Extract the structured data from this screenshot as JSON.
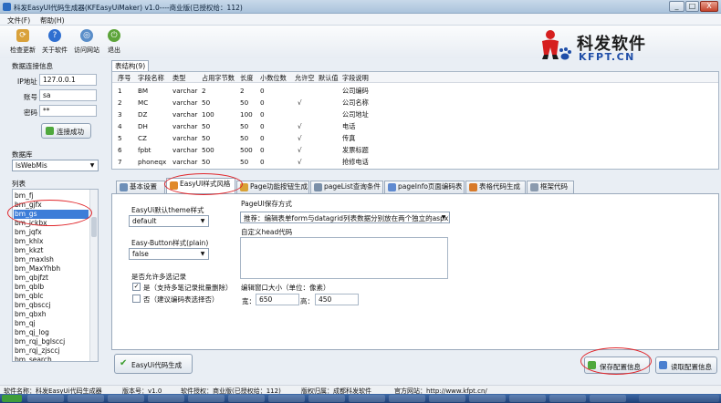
{
  "window": {
    "title": "科发EasyUI代码生成器(KFEasyUiMaker) v1.0----商业版(已授权给：112)",
    "min_label": "_",
    "max_label": "□",
    "close_label": "X"
  },
  "menu": [
    "文件(F)",
    "帮助(H)"
  ],
  "toolbar": {
    "items": [
      {
        "label": "检查更新",
        "icon": "refresh-icon"
      },
      {
        "label": "关于软件",
        "icon": "help-icon"
      },
      {
        "label": "访问网站",
        "icon": "globe-icon"
      },
      {
        "label": "退出",
        "icon": "exit-icon"
      }
    ]
  },
  "logo": {
    "cn": "科发软件",
    "en": "KFPT.CN"
  },
  "connection": {
    "section_title": "数据连接信息",
    "ip_label": "IP地址",
    "ip_value": "127.0.0.1",
    "account_label": "账号",
    "account_value": "sa",
    "password_label": "密码",
    "password_value": "**",
    "connect_status": "连接成功"
  },
  "database": {
    "label": "数据库",
    "selected": "lsWebMis"
  },
  "tables": {
    "label": "列表",
    "items": [
      "bm_fj",
      "bm_gjfx",
      "bm_gs",
      "bm_jckbx",
      "bm_jqfx",
      "bm_khlx",
      "bm_kkzt",
      "bm_maxlsh",
      "bm_MaxYhbh",
      "bm_qbjfzt",
      "bm_qblb",
      "bm_qblc",
      "bm_qbsccj",
      "bm_qbxh",
      "bm_qj",
      "bm_qj_log",
      "bm_rqj_bglsccj",
      "bm_rqj_zjsccj",
      "bm_search"
    ],
    "selected_index": 2
  },
  "structure": {
    "tab_label": "表结构(9)",
    "columns": [
      "序号",
      "字段名称",
      "类型",
      "占用字节数",
      "长度",
      "小数位数",
      "允许空",
      "默认值",
      "字段说明"
    ],
    "rows": [
      [
        "1",
        "BM",
        "varchar",
        "2",
        "2",
        "0",
        "",
        "",
        "公司编码"
      ],
      [
        "2",
        "MC",
        "varchar",
        "50",
        "50",
        "0",
        "√",
        "",
        "公司名称"
      ],
      [
        "3",
        "DZ",
        "varchar",
        "100",
        "100",
        "0",
        "",
        "",
        "公司地址"
      ],
      [
        "4",
        "DH",
        "varchar",
        "50",
        "50",
        "0",
        "√",
        "",
        "电话"
      ],
      [
        "5",
        "CZ",
        "varchar",
        "50",
        "50",
        "0",
        "√",
        "",
        "传真"
      ],
      [
        "6",
        "fpbt",
        "varchar",
        "500",
        "500",
        "0",
        "√",
        "",
        "发票标题"
      ],
      [
        "7",
        "phoneqx",
        "varchar",
        "50",
        "50",
        "0",
        "√",
        "",
        "抢修电话"
      ]
    ]
  },
  "tabs": [
    {
      "label": "基本设置",
      "color": "#6d8fb8"
    },
    {
      "label": "EasyUI样式风格",
      "color": "#e08a2a"
    },
    {
      "label": "Page功能按钮生成",
      "color": "#d9a236"
    },
    {
      "label": "pageList查询条件",
      "color": "#7a8fa8"
    },
    {
      "label": "pageInfo页面编码表",
      "color": "#5f8ad0"
    },
    {
      "label": "表格代码生成",
      "color": "#d87a2a"
    },
    {
      "label": "框架代码",
      "color": "#8a9aae"
    }
  ],
  "active_tab": 1,
  "style_panel": {
    "theme_label": "EasyUi默认theme样式",
    "theme_value": "default",
    "plain_label": "Easy-Button样式(plain)",
    "plain_value": "false",
    "multi_label": "是否允许多选记录",
    "multi_yes": "是（支持多笔记录批量删除）",
    "multi_no": "否（建议编码表选择否）",
    "multi_yes_checked": true,
    "multi_no_checked": false,
    "save_mode_label": "PageUI保存方式",
    "save_mode_value": "推荐：编辑表单form与datagrid列表数据分别放在两个独立的aspx页",
    "head_code_label": "自定义head代码",
    "window_size_label": "编辑窗口大小（单位：像素）",
    "width_label": "宽：",
    "width_value": "650",
    "height_label": "高：",
    "height_value": "450"
  },
  "actions": {
    "generate": "EasyUi代码生成",
    "save_config": "保存配置信息",
    "read_config": "读取配置信息"
  },
  "status": {
    "software_label": "软件名称：科发EasyUi代码生成器",
    "version_label": "版本号：v1.0",
    "license_label": "软件授权：商业版(已授权给：112)",
    "owner_label": "版权归属：成都科发软件",
    "website_label": "官方网站：http://www.kfpt.cn/"
  }
}
